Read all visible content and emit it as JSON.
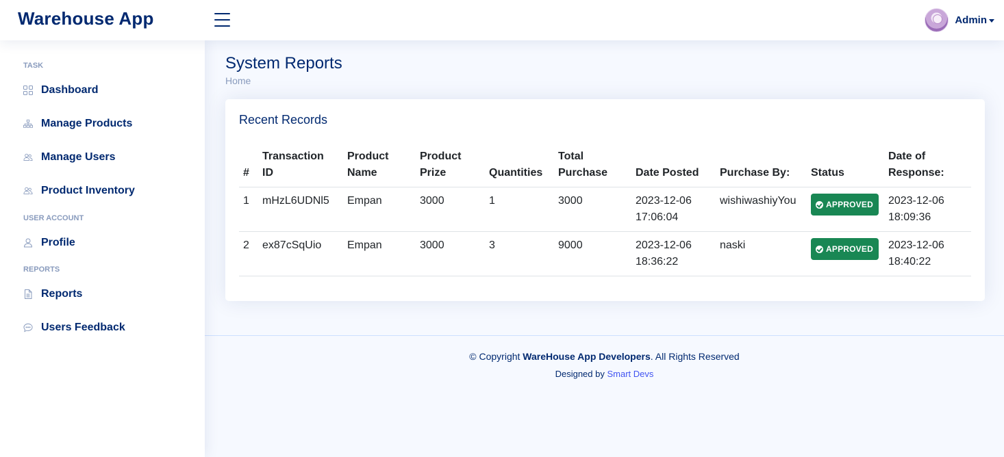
{
  "header": {
    "logo_text": "Warehouse App",
    "user_name": "Admin"
  },
  "sidebar": {
    "headings": {
      "task": "TASK",
      "user_account": "USER ACCOUNT",
      "reports": "REPORTS"
    },
    "items": [
      {
        "label": "Dashboard",
        "icon": "grid-icon"
      },
      {
        "label": "Manage Products",
        "icon": "diagram-icon"
      },
      {
        "label": "Manage Users",
        "icon": "people-icon"
      },
      {
        "label": "Product Inventory",
        "icon": "people-icon"
      },
      {
        "label": "Profile",
        "icon": "person-icon"
      },
      {
        "label": "Reports",
        "icon": "document-icon"
      },
      {
        "label": "Users Feedback",
        "icon": "chat-icon"
      }
    ]
  },
  "page": {
    "title": "System Reports",
    "breadcrumb": "Home"
  },
  "card": {
    "title": "Recent Records",
    "columns": [
      "#",
      "Transaction ID",
      "Product Name",
      "Product Prize",
      "Quantities",
      "Total Purchase",
      "Date Posted",
      "Purchase By:",
      "Status",
      "Date of Response:"
    ],
    "rows": [
      {
        "num": "1",
        "transaction_id": "mHzL6UDNl5",
        "product_name": "Empan",
        "product_prize": "3000",
        "quantities": "1",
        "total_purchase": "3000",
        "date_posted": "2023-12-06 17:06:04",
        "purchase_by": "wishiwashiyYou",
        "status": "APPROVED",
        "date_of_response": "2023-12-06 18:09:36"
      },
      {
        "num": "2",
        "transaction_id": "ex87cSqUio",
        "product_name": "Empan",
        "product_prize": "3000",
        "quantities": "3",
        "total_purchase": "9000",
        "date_posted": "2023-12-06 18:36:22",
        "purchase_by": "naski",
        "status": "APPROVED",
        "date_of_response": "2023-12-06 18:40:22"
      }
    ]
  },
  "footer": {
    "copyright_prefix": "© Copyright",
    "copyright_brand": "WareHouse App Developers",
    "copyright_suffix": ". All Rights Reserved",
    "designed_by_prefix": "Designed by",
    "designed_by_link": "Smart Devs"
  },
  "colors": {
    "primary": "#012970",
    "muted": "#899bbd",
    "success": "#198754",
    "link": "#4154f1",
    "background": "#f6f9ff"
  }
}
